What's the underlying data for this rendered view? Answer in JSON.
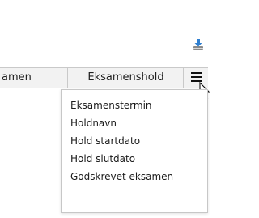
{
  "toolbar": {
    "export_icon": "download-icon"
  },
  "table": {
    "columns": [
      {
        "label": "amen"
      },
      {
        "label": "Eksamenshold"
      }
    ],
    "menu_icon": "hamburger-menu-icon"
  },
  "column_menu": {
    "items": [
      {
        "label": "Eksamenstermin"
      },
      {
        "label": "Holdnavn"
      },
      {
        "label": "Hold startdato"
      },
      {
        "label": "Hold slutdato"
      },
      {
        "label": "Godskrevet eksamen"
      }
    ]
  },
  "colors": {
    "header_bg": "#f2f2f2",
    "border": "#c9c9c9",
    "text": "#1f1f1f"
  }
}
